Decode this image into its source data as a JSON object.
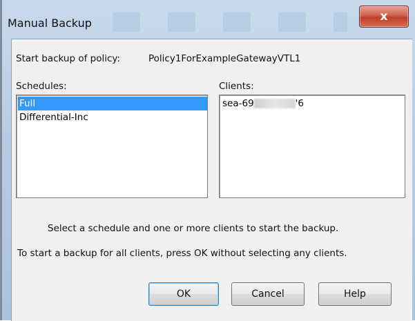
{
  "window": {
    "title": "Manual Backup",
    "close_glyph": "x"
  },
  "dialog": {
    "policy_label": "Start backup of policy:",
    "policy_name": "Policy1ForExampleGatewayVTL1",
    "schedules_label": "Schedules:",
    "clients_label": "Clients:",
    "schedules": [
      {
        "label": "Full",
        "selected": true
      },
      {
        "label": "Differential-Inc",
        "selected": false
      }
    ],
    "clients": [
      {
        "prefix": "sea-69",
        "suffix": "'6"
      }
    ],
    "instruction_1": "Select a schedule and one or more clients to start the backup.",
    "instruction_2": "To start a backup for all clients, press OK without selecting any clients."
  },
  "buttons": {
    "ok": "OK",
    "cancel": "Cancel",
    "help": "Help"
  },
  "colors": {
    "selection": "#3399ff",
    "close_button": "#c8503a"
  }
}
